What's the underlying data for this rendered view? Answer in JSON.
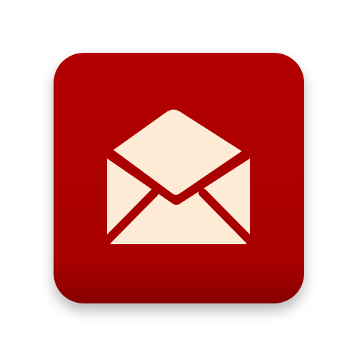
{
  "app_icon": {
    "icon": "open-envelope-icon",
    "colors": {
      "tile_top": "#b30000",
      "tile_mid": "#a90000",
      "tile_bottom": "#880000",
      "glyph": "#fdebd6",
      "glyph_stroke": "#a80000"
    }
  }
}
